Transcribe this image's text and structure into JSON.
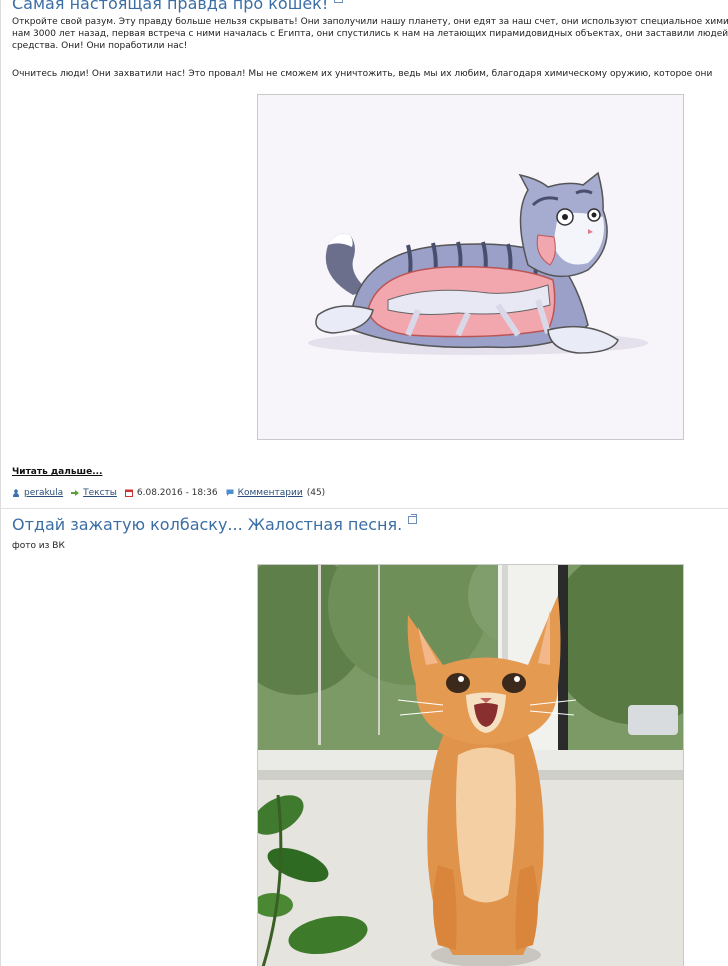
{
  "post1": {
    "title": "Самая настоящая правда про кошек!",
    "lines": [
      "Откройте свой разум. Эту правду больше нельзя скрывать! Они заполучили нашу планету, они едят за наш счет, они используют специальное химическое о",
      "нам 3000 лет назад, первая встреча с ними началась с Египта, они спустились к нам на летающих пирамидовидных объектах, они заставили людей за",
      "средства. Они! Они поработили нас!",
      "",
      "Очнитесь люди! Они захватили нас! Это провал! Мы не сможем их уничтожить, ведь мы их любим, благодаря химическому оружию, которое они"
    ],
    "read_more": "Читать дальше...",
    "meta": {
      "author": "perakula",
      "category": "Тексты",
      "date": "6.08.2016 - 18:36",
      "comments_label": "Комментарии",
      "comments_count": "(45)"
    }
  },
  "post2": {
    "title": "Отдай зажатую колбаску... Жалостная песня.",
    "caption": "фото из ВК"
  },
  "colors": {
    "link": "#3b6ea5",
    "meta_link": "#2b4f7a"
  }
}
